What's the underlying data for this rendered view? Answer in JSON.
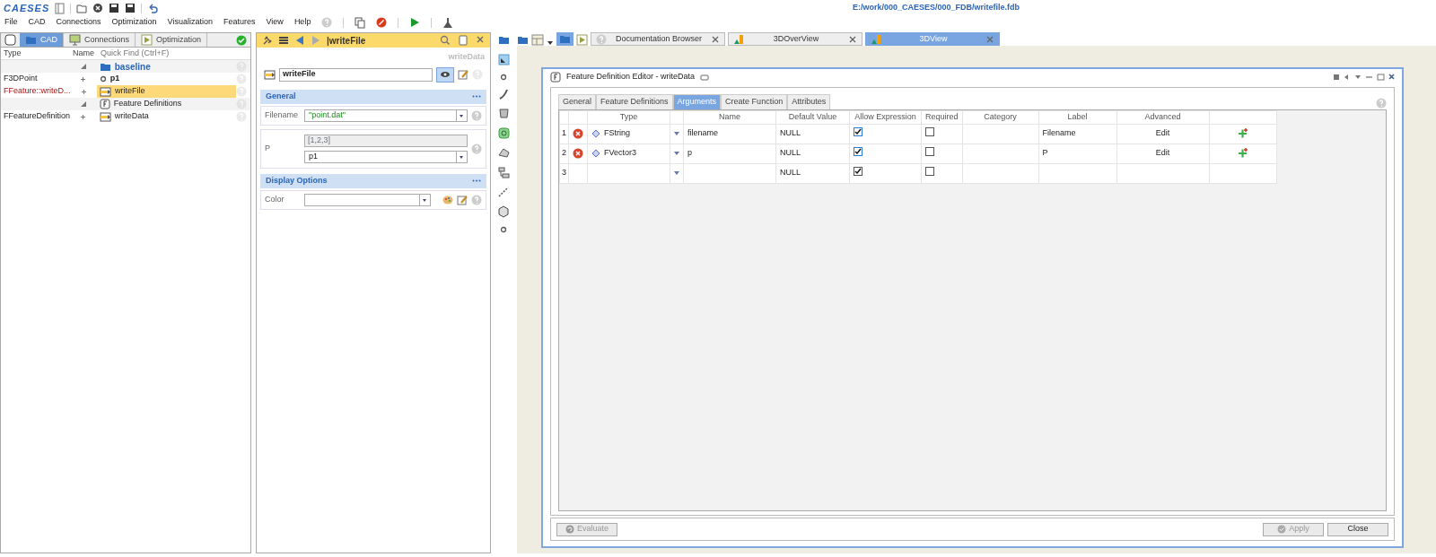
{
  "app": {
    "logo": "CAESES",
    "file_path": "E:/work/000_CAESES/000_FDB/writefile.fdb"
  },
  "menu": [
    "File",
    "CAD",
    "Connections",
    "Optimization",
    "Visualization",
    "Features",
    "View",
    "Help"
  ],
  "tree_panel": {
    "tabs": [
      {
        "label": "CAD",
        "selected": true
      },
      {
        "label": "Connections",
        "selected": false
      },
      {
        "label": "Optimization",
        "selected": false
      }
    ],
    "columns": [
      "Type",
      "Name"
    ],
    "quick_find": {
      "placeholder": "Quick Find (Ctrl+F)"
    },
    "rows": [
      {
        "kind": "folder",
        "name": "baseline",
        "selected": false
      },
      {
        "kind": "point",
        "type": "F3DPoint",
        "name": "p1",
        "selected": false,
        "error": false
      },
      {
        "kind": "feature",
        "type": "FFeature::writeD...",
        "name": "writeFile",
        "selected": true,
        "error": true
      },
      {
        "kind": "definitions",
        "name": "Feature Definitions",
        "selected": false
      },
      {
        "kind": "definition",
        "type": "FFeatureDefinition",
        "name": "writeData",
        "selected": false,
        "error": false
      }
    ]
  },
  "properties": {
    "title": "|writeFile",
    "subtitle": "writeData",
    "name": "writeFile",
    "sections": [
      {
        "title": "General",
        "fields": [
          {
            "kind": "combo",
            "label": "Filename",
            "value": "\"point.dat\""
          },
          {
            "kind": "vector",
            "label": "P",
            "preview": "[1,2,3]",
            "value": "p1"
          }
        ]
      },
      {
        "title": "Display Options",
        "fields": [
          {
            "kind": "color",
            "label": "Color"
          }
        ]
      }
    ]
  },
  "view_tabs": [
    {
      "label": "Documentation Browser",
      "selected": false
    },
    {
      "label": "3DOverView",
      "selected": false
    },
    {
      "label": "3DView",
      "selected": true
    }
  ],
  "dialog": {
    "title": "Feature Definition Editor - writeData",
    "tabs": [
      {
        "label": "General",
        "selected": false
      },
      {
        "label": "Feature Definitions",
        "selected": false
      },
      {
        "label": "Arguments",
        "selected": true
      },
      {
        "label": "Create Function",
        "selected": false
      },
      {
        "label": "Attributes",
        "selected": false
      }
    ],
    "columns": [
      "Type",
      "Name",
      "Default Value",
      "Allow Expression",
      "Required",
      "Category",
      "Label",
      "Advanced"
    ],
    "rows": [
      {
        "number": "1",
        "error": true,
        "type": "FString",
        "name": "filename",
        "default": "NULL",
        "allow_expression": true,
        "required": false,
        "label": "Filename",
        "advanced": "Edit"
      },
      {
        "number": "2",
        "error": true,
        "type": "FVector3",
        "name": "p",
        "default": "NULL",
        "allow_expression": true,
        "required": false,
        "label": "P",
        "advanced": "Edit"
      },
      {
        "number": "3",
        "error": false,
        "default": "NULL",
        "allow_expression": true,
        "required": false
      }
    ],
    "buttons": [
      {
        "label": "Evaluate",
        "disabled": true
      },
      {
        "label": "Apply",
        "disabled": true
      },
      {
        "label": "Close",
        "disabled": false
      }
    ]
  }
}
